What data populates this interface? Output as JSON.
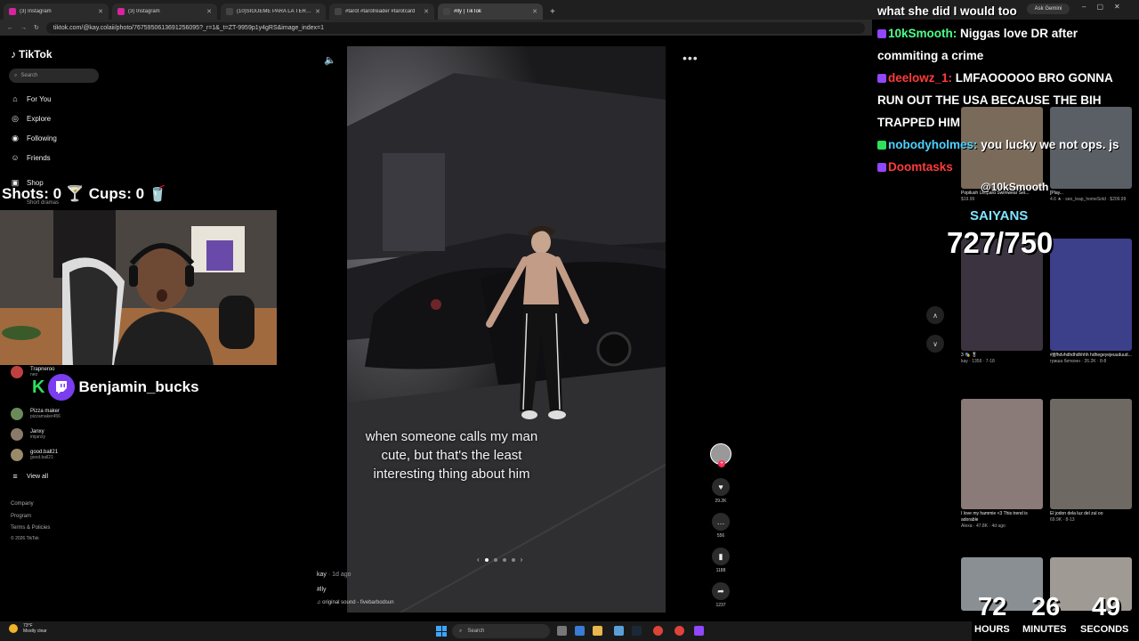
{
  "browser": {
    "tabs": [
      {
        "label": "(3) Instagram",
        "color": "#d6249f",
        "active": false
      },
      {
        "label": "(3) Instagram",
        "color": "#d6249f",
        "active": false
      },
      {
        "label": "(10)SIGUEME PARA LA TERCER",
        "color": "#111111",
        "active": false
      },
      {
        "label": "#tarot #tarotreader #tarotcard",
        "color": "#111111",
        "active": false
      },
      {
        "label": "#lly | TikTok",
        "color": "#111111",
        "active": true
      }
    ],
    "url": "tiktok.com/@kay.colaii/photo/7675950613691256095?_r=1&_t=ZT-9959p1y4gRS&image_index=1",
    "ask_gemini": "Ask Gemini"
  },
  "sidebar": {
    "logo": "TikTok",
    "search_placeholder": "Search",
    "nav": [
      {
        "label": "For You",
        "icon": "home-icon"
      },
      {
        "label": "Explore",
        "icon": "compass-icon"
      },
      {
        "label": "Following",
        "icon": "following-icon"
      },
      {
        "label": "Friends",
        "icon": "friends-icon"
      },
      {
        "label": "Shop",
        "icon": "shop-icon"
      },
      {
        "label": "Short dramas",
        "icon": "drama-icon"
      }
    ],
    "following": [
      {
        "name": "Trapneroo",
        "handle": "neo"
      },
      {
        "name": "Pizza maker",
        "handle": "pizzamaker456"
      },
      {
        "name": "Janxy",
        "handle": "imjanxy"
      },
      {
        "name": "good.ball21",
        "handle": "good.ball21"
      }
    ],
    "view_all": "View all",
    "footer": [
      "Company",
      "Program",
      "Terms & Policies",
      "© 2026 TikTok"
    ]
  },
  "overlay": {
    "shots_label": "Shots: 0",
    "cups_label": "Cups: 0",
    "streamer": "Benjamin_bucks"
  },
  "post": {
    "caption": "when someone calls my man cute, but that's the least interesting thing about him",
    "author": "kay",
    "date": "· 1d ago",
    "tag": "#lly",
    "sound": "original sound - fivebarbodsun",
    "likes": "29.2K",
    "comments": "556",
    "saves": "1188",
    "shares": "1237"
  },
  "chat": [
    {
      "user": "",
      "text": "what she did I would too"
    },
    {
      "user": "10kSmooth:",
      "text": " Niggas love DR after commiting a crime"
    },
    {
      "user": "deelowz_1:",
      "text": " LMFAOOOOO BRO GONNA RUN OUT THE USA BECAUSE THE BIH TRAPPED HIM"
    },
    {
      "user": "nobodyholmes:",
      "text": " you lucky we not ops. js"
    },
    {
      "user": "Doomtasks",
      "text": ""
    }
  ],
  "alerts": {
    "mention": "@10kSmooth",
    "team": "SAIYANS",
    "sub_goal": "727/750"
  },
  "grid": [
    {
      "t1": "Popilush Leopard Swimwear Set...",
      "t2": "$19.99",
      "color": "#7a6a5a"
    },
    {
      "t1": "[Play...",
      "t2": "4.6 ★ · seo_leap_homeSold · $209.99",
      "color": "#5a5f66"
    },
    {
      "t1": "3 🎭 🎖",
      "t2": "kay · 1356 · 7-18",
      "color": "#3b3340"
    },
    {
      "t1": "#jfjfhdvhdhdhdhhhh hdhegeyejeuuduud...",
      "t2": "гриша битконн · 26.2K · 8-8",
      "color": "#3c3f8a"
    },
    {
      "t1": "I love my hammie <3 This trend is adorable",
      "t2": "Alexa · 47.8K · 4d ago",
      "color": "#8a7a78"
    },
    {
      "t1": "El jodon dela luz del zul oo",
      "t2": "69.9K · 8-13",
      "color": "#6e6a63"
    },
    {
      "t1": "",
      "t2": "",
      "color": "#8a8f94"
    },
    {
      "t1": "",
      "t2": "",
      "color": "#a09a94"
    }
  ],
  "timer": {
    "hours": "72",
    "minutes": "26",
    "seconds": "49",
    "hours_label": "HOURS",
    "minutes_label": "MINUTES",
    "seconds_label": "SECONDS"
  },
  "taskbar": {
    "temp": "73°F",
    "weather": "Mostly clear",
    "search": "Search"
  },
  "colors": {
    "accent": "#fe2c55",
    "twitch": "#9146ff",
    "kick": "#2ee05a"
  }
}
